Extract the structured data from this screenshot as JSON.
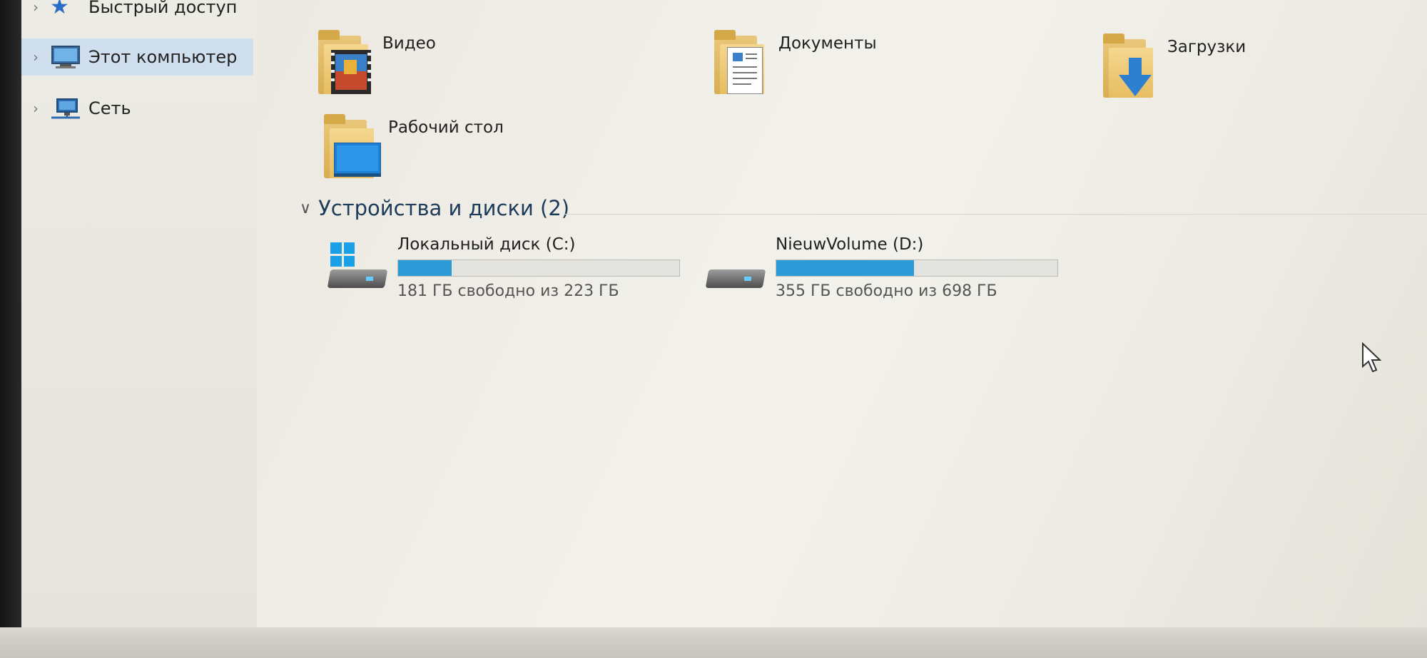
{
  "sidebar": {
    "items": [
      {
        "label": "Быстрый доступ",
        "icon": "star-icon",
        "selected": false
      },
      {
        "label": "Этот компьютер",
        "icon": "computer-icon",
        "selected": true
      },
      {
        "label": "Сеть",
        "icon": "network-icon",
        "selected": false
      }
    ]
  },
  "folders": [
    {
      "label": "Видео",
      "icon": "video-folder-icon"
    },
    {
      "label": "Документы",
      "icon": "documents-folder-icon"
    },
    {
      "label": "Загрузки",
      "icon": "downloads-folder-icon"
    },
    {
      "label": "Рабочий стол",
      "icon": "desktop-folder-icon"
    }
  ],
  "devices": {
    "header": "Устройства и диски (2)",
    "drives": [
      {
        "name": "Локальный диск (C:)",
        "free_text": "181 ГБ свободно из 223 ГБ",
        "used_fraction": 0.19,
        "icon": "system-drive-icon"
      },
      {
        "name": "NieuwVolume (D:)",
        "free_text": "355 ГБ свободно из 698 ГБ",
        "used_fraction": 0.49,
        "icon": "drive-icon"
      }
    ]
  },
  "colors": {
    "accent": "#2b9ad6",
    "selection": "#cfdfee",
    "folder": "#e6bd62"
  }
}
